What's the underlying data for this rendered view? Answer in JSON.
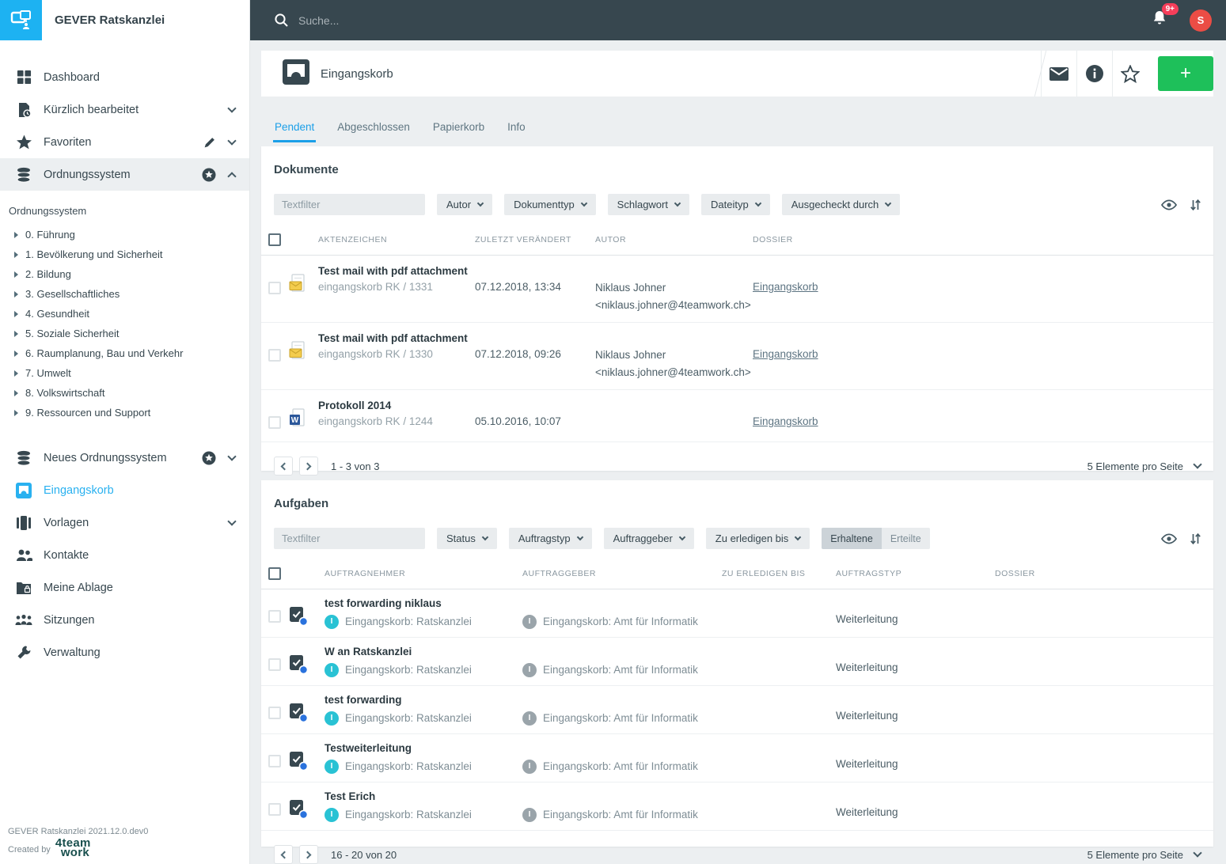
{
  "app": {
    "title": "GEVER Ratskanzlei",
    "footer_version": "GEVER Ratskanzlei 2021.12.0.dev0",
    "footer_created_by": "Created by",
    "vendor_logo_line1": "4team",
    "vendor_logo_line2": "work"
  },
  "topbar": {
    "search_placeholder": "Suche...",
    "notification_badge": "9+",
    "avatar_initial": "S"
  },
  "sidebar": {
    "nav_top": [
      {
        "label": "Dashboard"
      },
      {
        "label": "Kürzlich bearbeitet"
      },
      {
        "label": "Favoriten"
      },
      {
        "label": "Ordnungssystem"
      }
    ],
    "tree": {
      "heading": "Ordnungssystem",
      "items": [
        "0. Führung",
        "1. Bevölkerung und Sicherheit",
        "2. Bildung",
        "3. Gesellschaftliches",
        "4. Gesundheit",
        "5. Soziale Sicherheit",
        "6. Raumplanung, Bau und Verkehr",
        "7. Umwelt",
        "8. Volkswirtschaft",
        "9. Ressourcen und Support"
      ]
    },
    "nav_bottom": [
      {
        "label": "Neues Ordnungssystem"
      },
      {
        "label": "Eingangskorb"
      },
      {
        "label": "Vorlagen"
      },
      {
        "label": "Kontakte"
      },
      {
        "label": "Meine Ablage"
      },
      {
        "label": "Sitzungen"
      },
      {
        "label": "Verwaltung"
      }
    ]
  },
  "header": {
    "title": "Eingangskorb",
    "add_label": "+"
  },
  "tabs": {
    "items": [
      "Pendent",
      "Abgeschlossen",
      "Papierkorb",
      "Info"
    ],
    "active": "Pendent"
  },
  "documents": {
    "heading": "Dokumente",
    "filter_placeholder": "Textfilter",
    "filters": [
      "Autor",
      "Dokumenttyp",
      "Schlagwort",
      "Dateityp",
      "Ausgecheckt durch"
    ],
    "columns": [
      "AKTENZEICHEN",
      "ZULETZT VERÄNDERT",
      "AUTOR",
      "DOSSIER"
    ],
    "rows": [
      {
        "title": "Test mail with pdf attachment",
        "reference": "eingangskorb RK / 1331",
        "modified": "07.12.2018, 13:34",
        "author_name": "Niklaus Johner",
        "author_email": "<niklaus.johner@4teamwork.ch>",
        "dossier": "Eingangskorb"
      },
      {
        "title": "Test mail with pdf attachment",
        "reference": "eingangskorb RK / 1330",
        "modified": "07.12.2018, 09:26",
        "author_name": "Niklaus Johner",
        "author_email": "<niklaus.johner@4teamwork.ch>",
        "dossier": "Eingangskorb"
      },
      {
        "title": "Protokoll 2014",
        "reference": "eingangskorb RK / 1244",
        "modified": "05.10.2016, 10:07",
        "author_name": "",
        "author_email": "",
        "dossier": "Eingangskorb"
      }
    ],
    "pagination": {
      "range": "1 - 3 von 3",
      "per_page": "5 Elemente pro Seite"
    }
  },
  "tasks": {
    "heading": "Aufgaben",
    "filter_placeholder": "Textfilter",
    "filters": [
      "Status",
      "Auftragstyp",
      "Auftraggeber",
      "Zu erledigen bis"
    ],
    "toggle": {
      "received": "Erhaltene",
      "issued": "Erteilte"
    },
    "columns": [
      "AUFTRAGNEHMER",
      "AUFTRAGGEBER",
      "ZU ERLEDIGEN BIS",
      "AUFTRAGSTYP",
      "DOSSIER"
    ],
    "badge_letter": "I",
    "rows": [
      {
        "title": "test forwarding niklaus",
        "assignee": "Eingangskorb: Ratskanzlei",
        "issuer": "Eingangskorb: Amt für Informatik",
        "due": "",
        "type": "Weiterleitung",
        "dossier": ""
      },
      {
        "title": "W an Ratskanzlei",
        "assignee": "Eingangskorb: Ratskanzlei",
        "issuer": "Eingangskorb: Amt für Informatik",
        "due": "",
        "type": "Weiterleitung",
        "dossier": ""
      },
      {
        "title": "test forwarding",
        "assignee": "Eingangskorb: Ratskanzlei",
        "issuer": "Eingangskorb: Amt für Informatik",
        "due": "",
        "type": "Weiterleitung",
        "dossier": ""
      },
      {
        "title": "Testweiterleitung",
        "assignee": "Eingangskorb: Ratskanzlei",
        "issuer": "Eingangskorb: Amt für Informatik",
        "due": "",
        "type": "Weiterleitung",
        "dossier": ""
      },
      {
        "title": "Test Erich",
        "assignee": "Eingangskorb: Ratskanzlei",
        "issuer": "Eingangskorb: Amt für Informatik",
        "due": "",
        "type": "Weiterleitung",
        "dossier": ""
      }
    ],
    "pagination": {
      "range": "16 - 20 von 20",
      "per_page": "5 Elemente pro Seite"
    }
  },
  "icons": {
    "word_letter": "W"
  },
  "colors": {
    "topbar": "#37474f",
    "accent_blue": "#1b9fe8",
    "sidebar_active_blue": "#29b1f0",
    "add_green": "#1ec05a",
    "badge_red": "#f63e5a",
    "avatar_red": "#eb4d45",
    "teal_badge": "#29c2d4",
    "gray_badge": "#9aa4aa",
    "page_bg": "#eceff1"
  }
}
